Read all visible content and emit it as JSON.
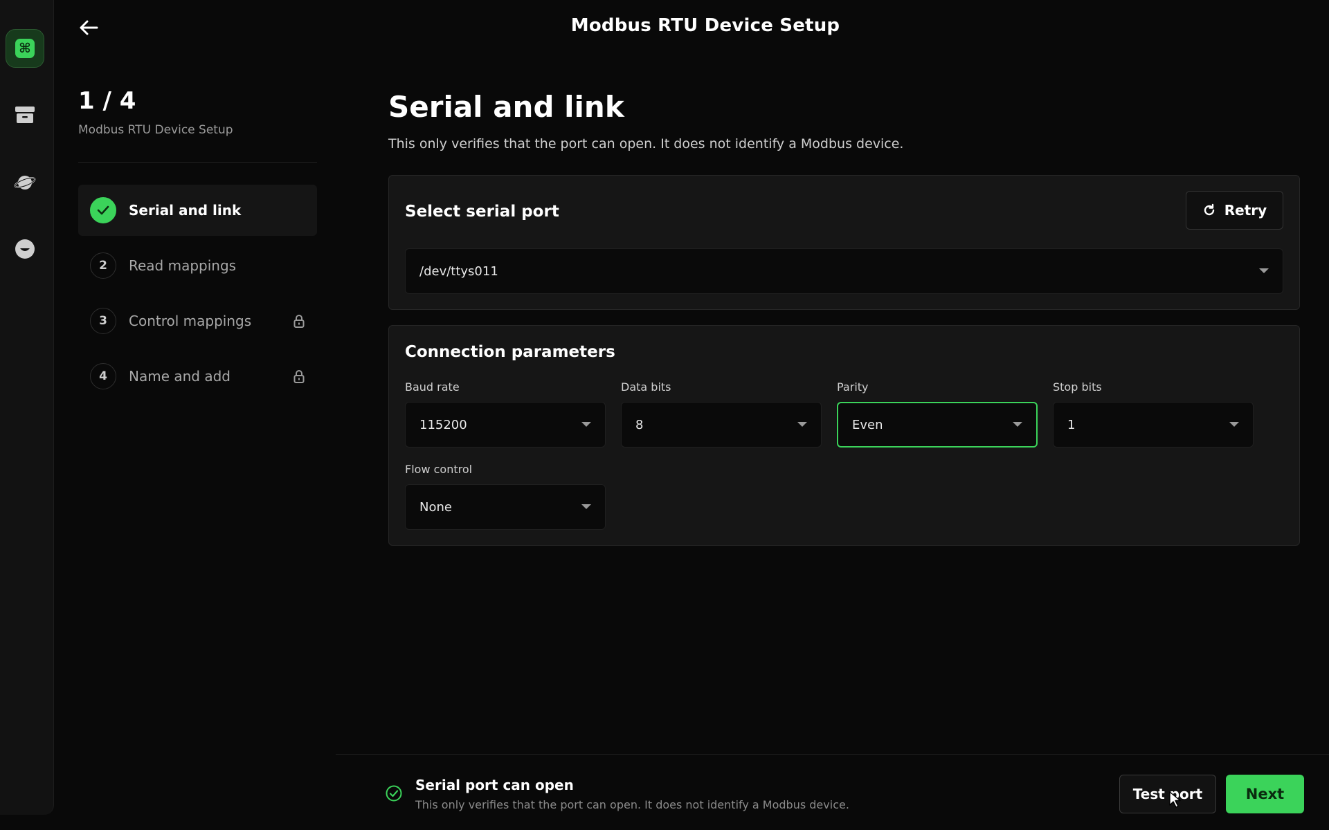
{
  "colors": {
    "accent": "#3bd35a",
    "background": "#090909",
    "card": "#161616"
  },
  "rail": {
    "items": [
      {
        "icon": "command-icon",
        "active": true
      },
      {
        "icon": "archive-icon",
        "active": false
      },
      {
        "icon": "planet-icon",
        "active": false
      },
      {
        "icon": "smiley-icon",
        "active": false
      }
    ]
  },
  "header": {
    "title": "Modbus RTU Device Setup",
    "back_icon": "arrow-left-icon"
  },
  "stepper": {
    "count": "1 / 4",
    "subtitle": "Modbus RTU Device Setup",
    "steps": [
      {
        "number": "1",
        "label": "Serial and link",
        "state": "done",
        "locked": false
      },
      {
        "number": "2",
        "label": "Read mappings",
        "state": "pending",
        "locked": false
      },
      {
        "number": "3",
        "label": "Control mappings",
        "state": "pending",
        "locked": true
      },
      {
        "number": "4",
        "label": "Name and add",
        "state": "pending",
        "locked": true
      }
    ]
  },
  "main": {
    "title": "Serial and link",
    "description": "This only verifies that the port can open. It does not identify a Modbus device.",
    "port_card": {
      "title": "Select serial port",
      "retry_label": "Retry",
      "selected_port": "/dev/ttys011"
    },
    "params_card": {
      "title": "Connection parameters",
      "baud_rate": {
        "label": "Baud rate",
        "value": "115200"
      },
      "data_bits": {
        "label": "Data bits",
        "value": "8"
      },
      "parity": {
        "label": "Parity",
        "value": "Even"
      },
      "stop_bits": {
        "label": "Stop bits",
        "value": "1"
      },
      "flow_control": {
        "label": "Flow control",
        "value": "None"
      }
    }
  },
  "footer": {
    "status_title": "Serial port can open",
    "status_desc": "This only verifies that the port can open. It does not identify a Modbus device.",
    "test_label": "Test port",
    "next_label": "Next"
  }
}
